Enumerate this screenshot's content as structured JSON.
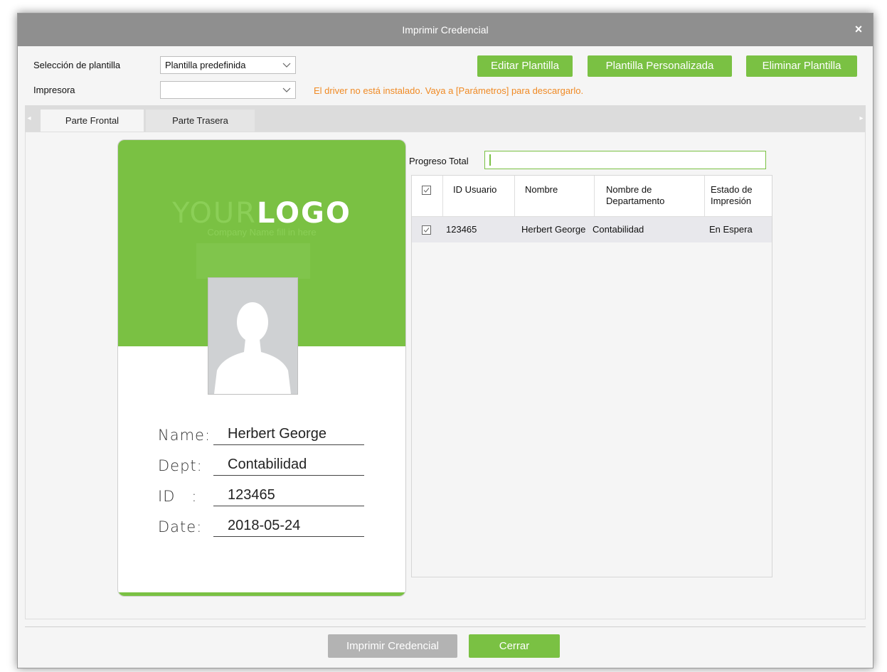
{
  "dialog": {
    "title": "Imprimir Credencial",
    "close_glyph": "×"
  },
  "form": {
    "template_label": "Selección de plantilla",
    "template_value": "Plantilla predefinida",
    "printer_label": "Impresora",
    "printer_value": "",
    "warning": "El driver no está instalado. Vaya a [Parámetros] para descargarlo."
  },
  "toolbar": {
    "edit_label": "Editar Plantilla",
    "custom_label": "Plantilla Personalizada",
    "delete_label": "Eliminar Plantilla"
  },
  "tabs": [
    {
      "label": "Parte Frontal",
      "active": true
    },
    {
      "label": "Parte Trasera",
      "active": false
    }
  ],
  "card": {
    "logo_part1": "YOUR",
    "logo_part2": "LOGO",
    "company": "Company Name fill in here",
    "fields": [
      {
        "key": "Name:",
        "value": "Herbert George"
      },
      {
        "key": "Dept:",
        "value": "Contabilidad"
      },
      {
        "key": "ID   :",
        "value": "123465"
      },
      {
        "key": "Date:",
        "value": "2018-05-24"
      }
    ]
  },
  "progress": {
    "label": "Progreso Total"
  },
  "table": {
    "headers": [
      "ID Usuario",
      "Nombre",
      "Nombre de Departamento",
      "Estado de Impresión"
    ],
    "rows": [
      {
        "id": "123465",
        "name": "Herbert George",
        "dept": "Contabilidad",
        "status": "En Espera",
        "checked": true
      }
    ]
  },
  "footer": {
    "print_label": "Imprimir Credencial",
    "close_label": "Cerrar"
  },
  "colors": {
    "accent": "#7ac143",
    "warning": "#f08a24",
    "titlebar": "#8f8f8f"
  }
}
